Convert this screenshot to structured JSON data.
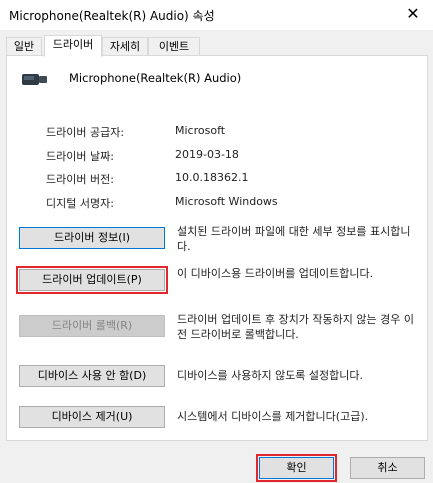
{
  "window": {
    "title": "Microphone(Realtek(R) Audio) 속성",
    "close_glyph": "✕"
  },
  "tabs": [
    {
      "label": "일반",
      "active": false
    },
    {
      "label": "드라이버",
      "active": true
    },
    {
      "label": "자세히",
      "active": false
    },
    {
      "label": "이벤트",
      "active": false
    }
  ],
  "device": {
    "name": "Microphone(Realtek(R) Audio)",
    "icon": "microphone-device-icon"
  },
  "properties": [
    {
      "label": "드라이버 공급자:",
      "value": "Microsoft"
    },
    {
      "label": "드라이버 날짜:",
      "value": "2019-03-18"
    },
    {
      "label": "드라이버 버전:",
      "value": "10.0.18362.1"
    },
    {
      "label": "디지털 서명자:",
      "value": "Microsoft Windows"
    }
  ],
  "actions": [
    {
      "button": "드라이버 정보(I)",
      "description": "설치된 드라이버 파일에 대한 세부 정보를 표시합니다."
    },
    {
      "button": "드라이버 업데이트(P)",
      "description": "이 디바이스용 드라이버를 업데이트합니다."
    },
    {
      "button": "드라이버 롤백(R)",
      "description": "드라이버 업데이트 후 장치가 작동하지 않는 경우 이전 드라이버로 롤백합니다."
    },
    {
      "button": "디바이스 사용 안 함(D)",
      "description": "디바이스를 사용하지 않도록 설정합니다."
    },
    {
      "button": "디바이스 제거(U)",
      "description": "시스템에서 디바이스를 제거합니다(고급)."
    }
  ],
  "footer": {
    "ok_label": "확인",
    "cancel_label": "취소"
  },
  "colors": {
    "highlight_outline": "#e0262e",
    "focus_border": "#0078d7"
  }
}
